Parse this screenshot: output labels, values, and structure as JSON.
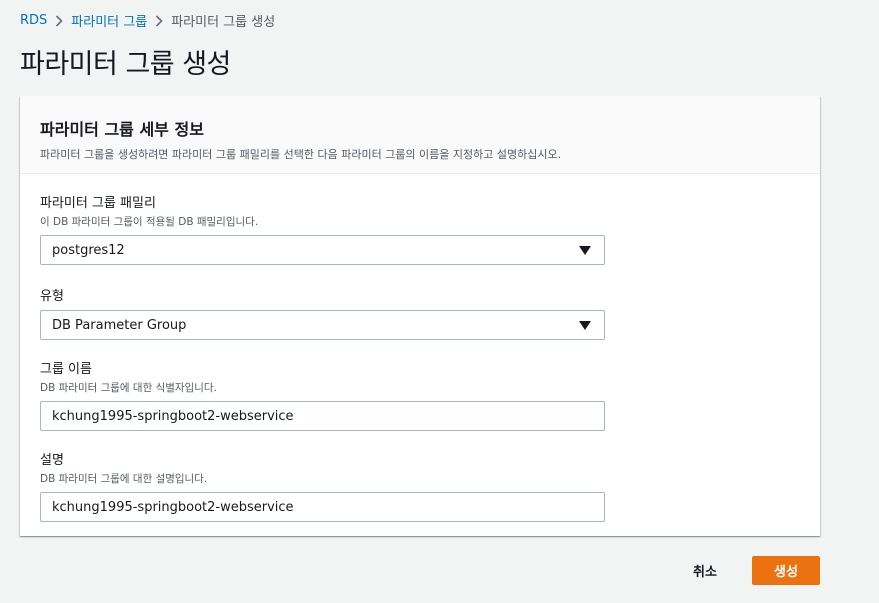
{
  "breadcrumb": {
    "items": [
      "RDS",
      "파라미터 그룹",
      "파라미터 그룹 생성"
    ]
  },
  "page": {
    "title": "파라미터 그룹 생성"
  },
  "panel": {
    "title": "파라미터 그룹 세부 정보",
    "description": "파라미터 그룹을 생성하려면 파라미터 그룹 패밀리를 선택한 다음 파라미터 그룹의 이름을 지정하고 설명하십시오."
  },
  "fields": {
    "family": {
      "label": "파라미터 그룹 패밀리",
      "description": "이 DB 파라미터 그룹이 적용될 DB 패밀리입니다.",
      "value": "postgres12"
    },
    "type": {
      "label": "유형",
      "value": "DB Parameter Group"
    },
    "group_name": {
      "label": "그룹 이름",
      "description": "DB 파라미터 그룹에 대한 식별자입니다.",
      "value": "kchung1995-springboot2-webservice"
    },
    "description": {
      "label": "설명",
      "description": "DB 파라미터 그룹에 대한 설명입니다.",
      "value": "kchung1995-springboot2-webservice"
    }
  },
  "footer": {
    "cancel_label": "취소",
    "create_label": "생성"
  },
  "colors": {
    "link": "#0073bb",
    "primary_button": "#ec7211",
    "background": "#f2f3f3"
  }
}
